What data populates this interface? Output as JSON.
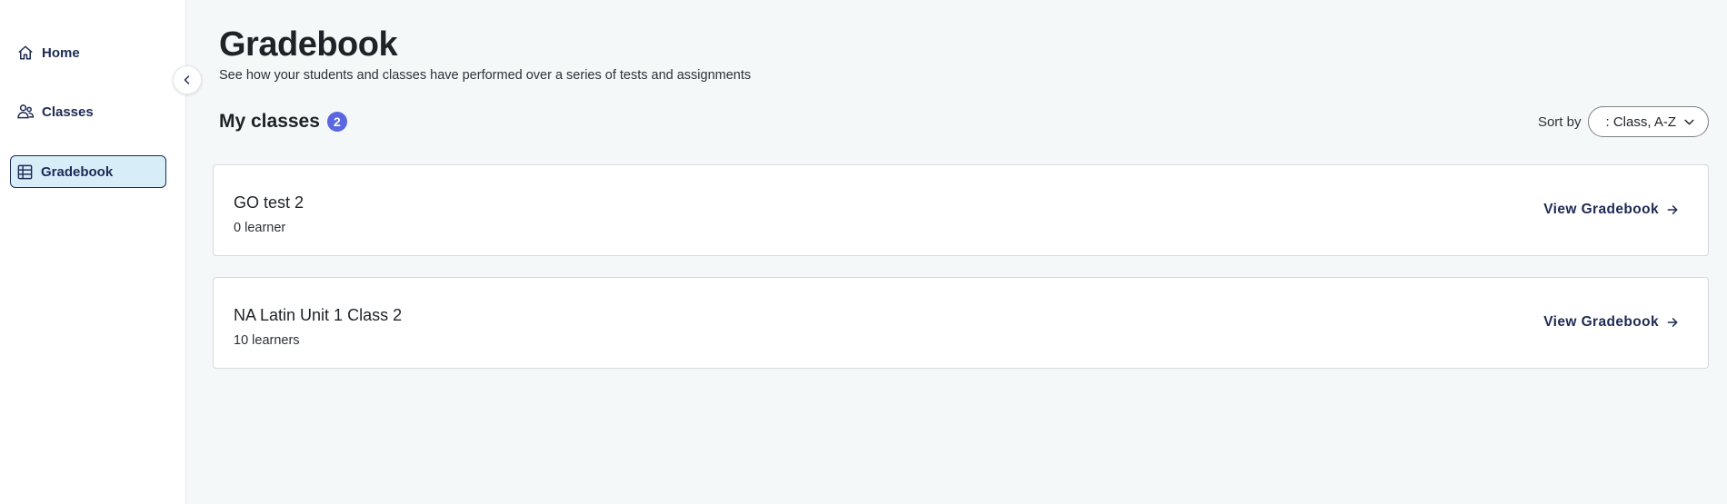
{
  "sidebar": {
    "items": [
      {
        "label": "Home",
        "icon": "home-icon"
      },
      {
        "label": "Classes",
        "icon": "users-icon"
      },
      {
        "label": "Gradebook",
        "icon": "table-icon",
        "active": true
      }
    ]
  },
  "header": {
    "title": "Gradebook",
    "subtitle": "See how your students and classes have performed over a series of tests and assignments"
  },
  "classes_section": {
    "title": "My classes",
    "count": "2"
  },
  "sort": {
    "label": "Sort by",
    "selected": ": Class, A-Z"
  },
  "classes": [
    {
      "name": "GO test 2",
      "learners": "0 learner",
      "link": "View Gradebook"
    },
    {
      "name": "NA Latin Unit 1 Class 2",
      "learners": "10 learners",
      "link": "View Gradebook"
    }
  ],
  "colors": {
    "accent": "#5a67e0",
    "nav_text": "#1d2a55",
    "active_bg": "#d7eef9",
    "page_bg": "#f5f8f9"
  }
}
